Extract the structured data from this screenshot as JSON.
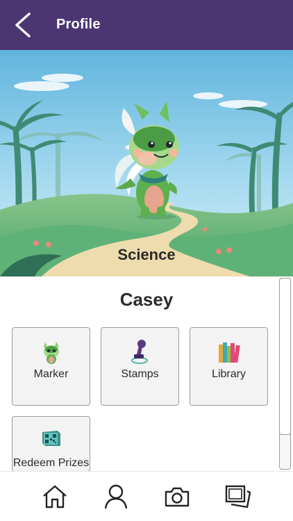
{
  "header": {
    "title": "Profile",
    "back_icon": "chevron-left-icon",
    "background": "#4b3672"
  },
  "hero": {
    "label": "Science",
    "character": "green-dragon-mascot"
  },
  "user": {
    "name": "Casey"
  },
  "tiles": [
    {
      "label": "Marker",
      "icon": "dragon-marker-icon"
    },
    {
      "label": "Stamps",
      "icon": "stamp-icon"
    },
    {
      "label": "Library",
      "icon": "books-icon"
    },
    {
      "label": "Redeem Prizes",
      "icon": "qr-code-icon"
    }
  ],
  "bottom_nav": {
    "items": [
      {
        "icon": "home-icon"
      },
      {
        "icon": "profile-icon"
      },
      {
        "icon": "camera-icon"
      },
      {
        "icon": "gallery-icon"
      }
    ]
  }
}
